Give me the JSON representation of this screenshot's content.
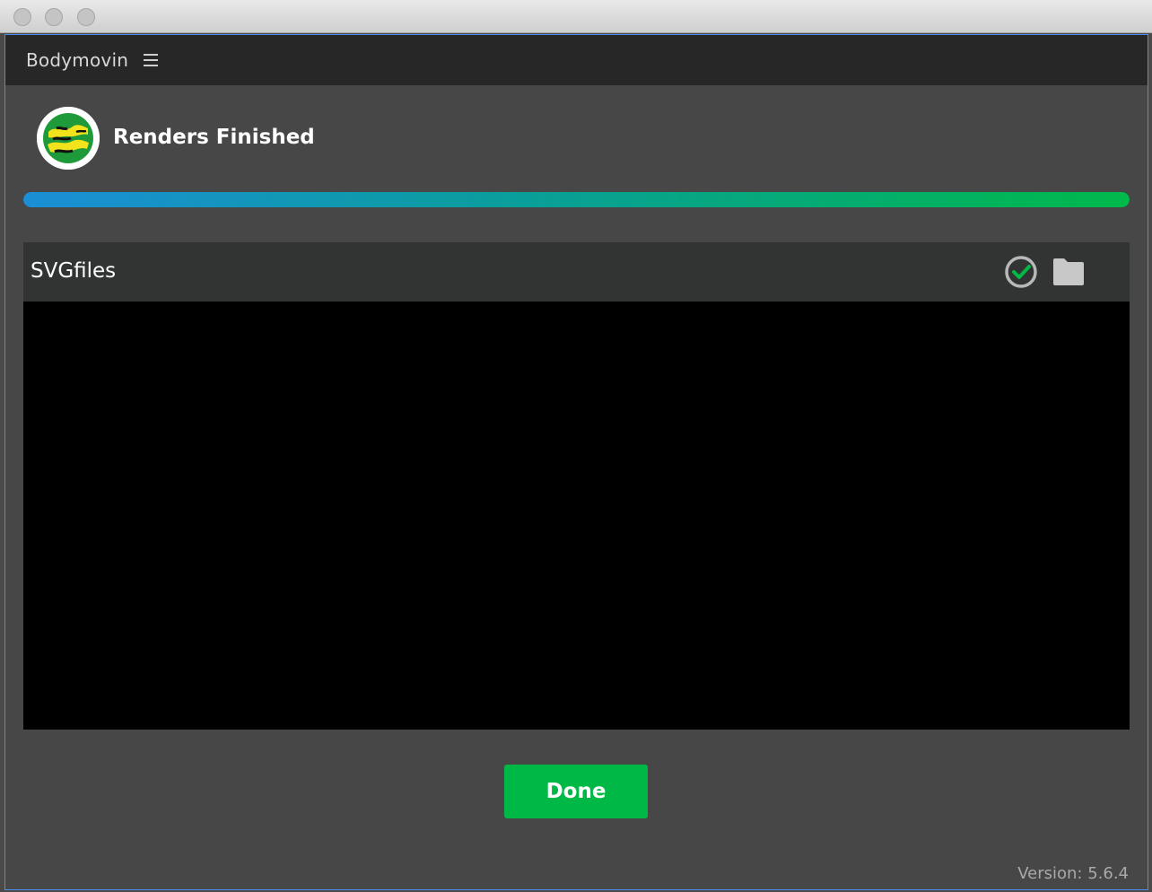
{
  "header": {
    "app_title": "Bodymovin",
    "menu_icon": "hamburger-menu-icon"
  },
  "status": {
    "title": "Renders Finished",
    "logo_icon": "bodymovin-logo-icon",
    "progress_fraction": 1.0
  },
  "renders": [
    {
      "name": "SVGfiles",
      "status_icon": "check-circle-icon",
      "folder_icon": "folder-icon"
    }
  ],
  "footer": {
    "done_label": "Done",
    "version_text": "Version: 5.6.4"
  },
  "colors": {
    "accent_green": "#00b845",
    "progress_start": "#1b8fd6",
    "progress_end": "#00b94a"
  }
}
